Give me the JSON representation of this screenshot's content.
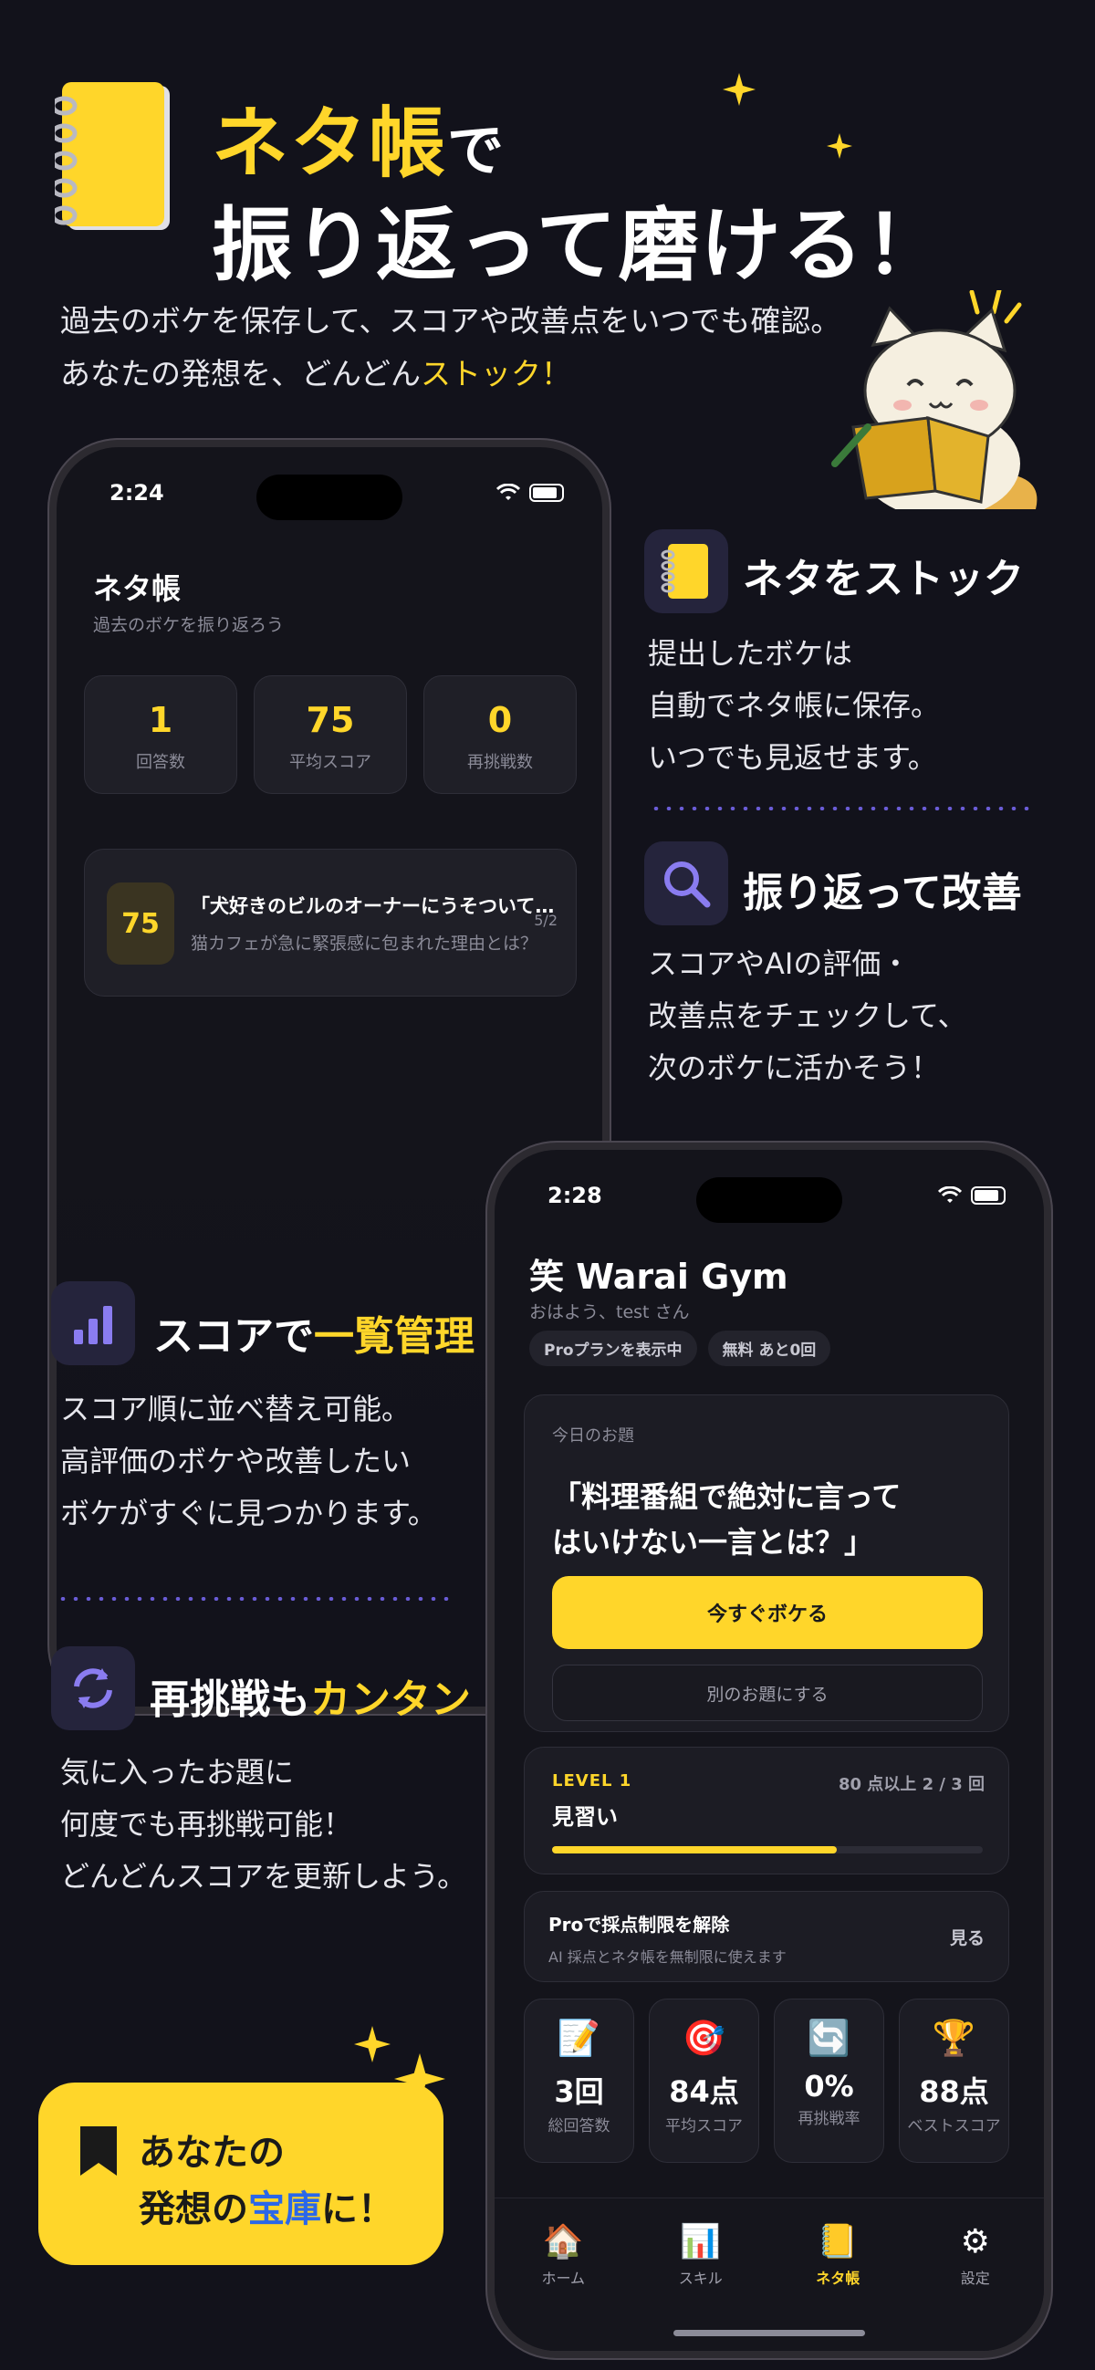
{
  "colors": {
    "background": "#12121b",
    "accent": "#ffd62a",
    "purple": "#6a5cd6",
    "link_blue": "#2b67e8"
  },
  "hero": {
    "title_accent": "ネタ帳",
    "title_suffix": "で",
    "title_line2": "振り返って磨ける！",
    "sub_line1": "過去のボケを保存して、スコアや改善点をいつでも確認。",
    "sub_line2_prefix": "あなたの発想を、どんどん",
    "sub_line2_accent": "ストック！"
  },
  "phone1": {
    "time": "2:24",
    "title": "ネタ帳",
    "subtitle": "過去のボケを振り返ろう",
    "stats": [
      {
        "value": "1",
        "label": "回答数"
      },
      {
        "value": "75",
        "label": "平均スコア"
      },
      {
        "value": "0",
        "label": "再挑戦数"
      }
    ],
    "entry": {
      "score": "75",
      "title": "「犬好きのビルのオーナーにうそついて…",
      "subtitle": "猫カフェが急に緊張感に包まれた理由とは？",
      "date": "5/2"
    }
  },
  "features": {
    "stock": {
      "icon": "notebook-icon",
      "title": "ネタをストック",
      "body": [
        "提出したボケは",
        "自動でネタ帳に保存。",
        "いつでも見返せます。"
      ]
    },
    "review": {
      "icon": "magnifier-icon",
      "title": "振り返って改善",
      "body": [
        "スコアやAIの評価・",
        "改善点をチェックして、",
        "次のボケに活かそう！"
      ]
    },
    "score": {
      "icon": "bar-chart-icon",
      "title_prefix": "スコアで",
      "title_accent": "一覧管理",
      "body": [
        "スコア順に並べ替え可能。",
        "高評価のボケや改善したい",
        "ボケがすぐに見つかります。"
      ]
    },
    "retry": {
      "icon": "refresh-icon",
      "title_prefix": "再挑戦も",
      "title_accent": "カンタン",
      "body": [
        "気に入ったお題に",
        "何度でも再挑戦可能！",
        "どんどんスコアを更新しよう。"
      ]
    }
  },
  "phone2": {
    "time": "2:28",
    "app_name": "笑 Warai Gym",
    "greeting": "おはよう、test さん",
    "chips": [
      "Proプランを表示中",
      "無料 あと0回"
    ],
    "today": {
      "caption": "今日のお題",
      "question_line1": "「料理番組で絶対に言って",
      "question_line2": "はいけない一言とは？」",
      "primary_button": "今すぐボケる",
      "secondary_button": "別のお題にする"
    },
    "level": {
      "level_label": "LEVEL 1",
      "rank": "見習い",
      "requirement": "80 点以上 2 / 3 回",
      "progress_fraction": 0.66
    },
    "pro": {
      "title": "Proで採点制限を解除",
      "subtitle": "AI 採点とネタ帳を無制限に使えます",
      "action": "見る"
    },
    "stats": [
      {
        "icon": "memo-icon",
        "glyph": "📝",
        "value": "3回",
        "label": "総回答数"
      },
      {
        "icon": "target-icon",
        "glyph": "🎯",
        "value": "84点",
        "label": "平均スコア"
      },
      {
        "icon": "retry-icon",
        "glyph": "🔄",
        "value": "0%",
        "label": "再挑戦率"
      },
      {
        "icon": "trophy-icon",
        "glyph": "🏆",
        "value": "88点",
        "label": "ベストスコア"
      }
    ],
    "tabs": [
      {
        "icon": "home-icon",
        "glyph": "🏠",
        "label": "ホーム",
        "active": false
      },
      {
        "icon": "skill-chart-icon",
        "glyph": "📊",
        "label": "スキル",
        "active": false
      },
      {
        "icon": "notebook-icon",
        "glyph": "📒",
        "label": "ネタ帳",
        "active": true
      },
      {
        "icon": "gear-icon",
        "glyph": "⚙",
        "label": "設定",
        "active": false
      }
    ]
  },
  "badge": {
    "line1": "あなたの",
    "line2_prefix": "発想の",
    "line2_accent": "宝庫",
    "line2_suffix": "に！"
  }
}
